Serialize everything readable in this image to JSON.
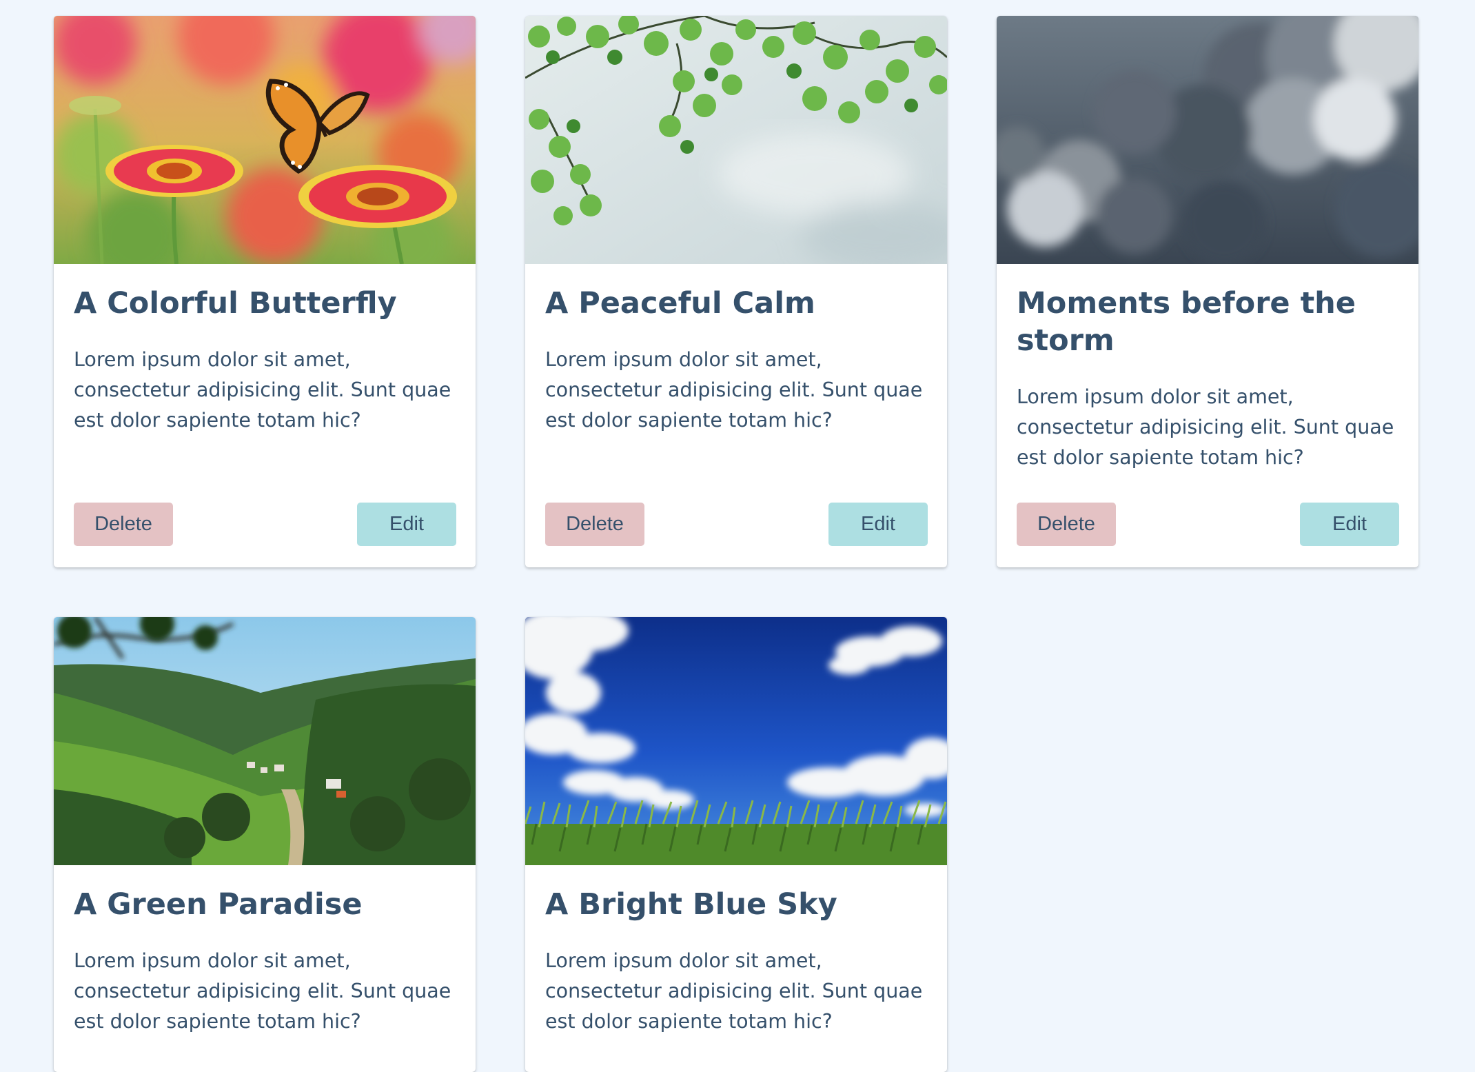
{
  "cards": [
    {
      "title": "A Colorful Butterfly",
      "text": "Lorem ipsum dolor sit amet, consectetur adipisicing elit. Sunt quae est dolor sapiente totam hic?",
      "delete_label": "Delete",
      "edit_label": "Edit",
      "image": "butterfly-on-flowers"
    },
    {
      "title": "A Peaceful Calm",
      "text": "Lorem ipsum dolor sit amet, consectetur adipisicing elit. Sunt quae est dolor sapiente totam hic?",
      "delete_label": "Delete",
      "edit_label": "Edit",
      "image": "green-leaves-sky"
    },
    {
      "title": "Moments before the storm",
      "text": "Lorem ipsum dolor sit amet, consectetur adipisicing elit. Sunt quae est dolor sapiente totam hic?",
      "delete_label": "Delete",
      "edit_label": "Edit",
      "image": "storm-clouds"
    },
    {
      "title": "A Green Paradise",
      "text": "Lorem ipsum dolor sit amet, consectetur adipisicing elit. Sunt quae est dolor sapiente totam hic?",
      "image": "green-valley"
    },
    {
      "title": "A Bright Blue Sky",
      "text": "Lorem ipsum dolor sit amet, consectetur adipisicing elit. Sunt quae est dolor sapiente totam hic?",
      "image": "blue-sky-grass"
    }
  ],
  "colors": {
    "page_background": "#f0f6fd",
    "card_background": "#ffffff",
    "text": "#35506b",
    "delete_button": "#e4c2c4",
    "edit_button": "#addfe2"
  }
}
